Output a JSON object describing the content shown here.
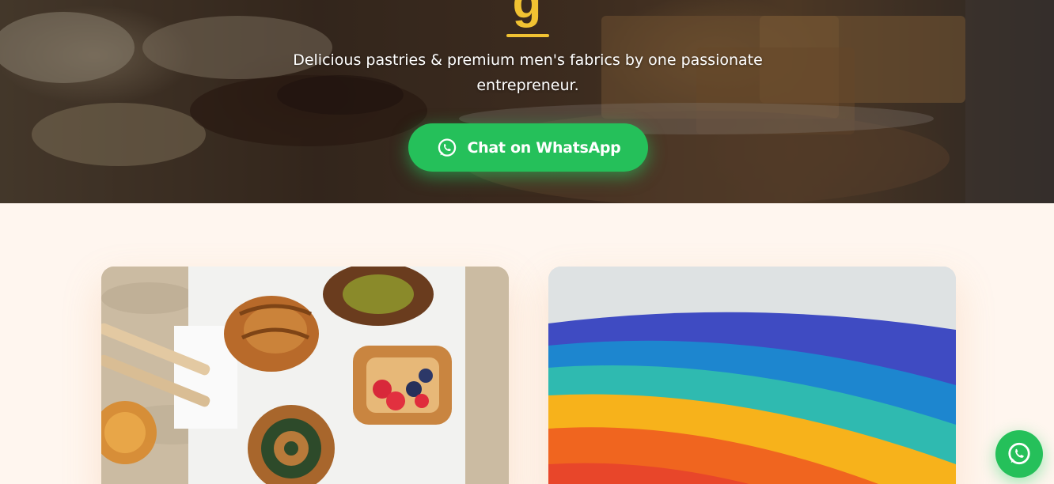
{
  "hero": {
    "heading_visible_fragment": "g",
    "tagline": "Delicious pastries & premium men's fabrics by one passionate entrepreneur.",
    "cta": {
      "label": "Chat on WhatsApp",
      "icon": "whatsapp-icon"
    },
    "accent_color": "#f1c232"
  },
  "cards": [
    {
      "category": "pastries",
      "image": "pastries-photo"
    },
    {
      "category": "fabrics",
      "image": "fabrics-photo"
    }
  ],
  "floating_button": {
    "icon": "whatsapp-icon"
  },
  "colors": {
    "whatsapp_green": "#25c05a",
    "section_background": "#fff6ef",
    "accent_yellow": "#f1c232"
  }
}
